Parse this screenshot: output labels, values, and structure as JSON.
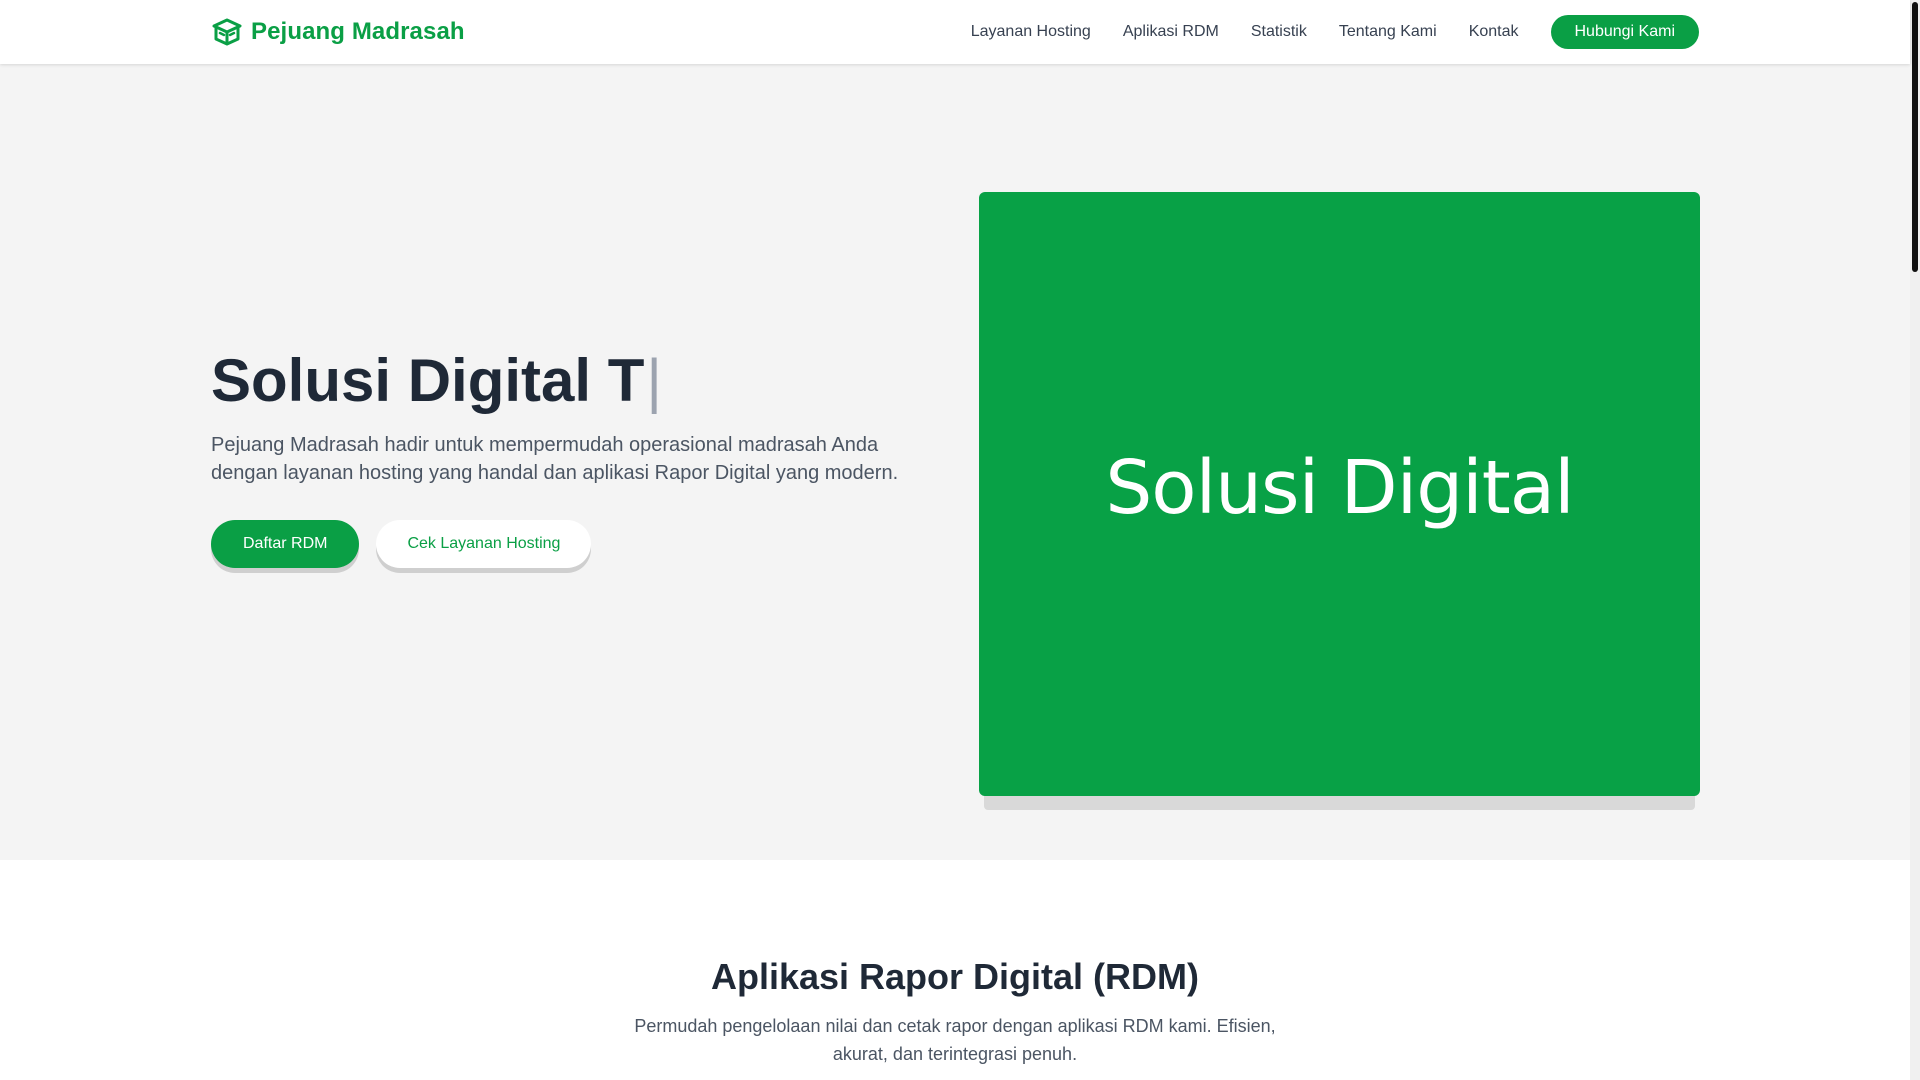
{
  "navbar": {
    "brand_name": "Pejuang Madrasah",
    "brand_icon": "madrasah-book-icon",
    "links": [
      "Layanan Hosting",
      "Aplikasi RDM",
      "Statistik",
      "Tentang Kami",
      "Kontak"
    ],
    "cta_label": "Hubungi Kami"
  },
  "hero": {
    "title_text": "Solusi Digital T",
    "cursor": "|",
    "description": "Pejuang Madrasah hadir untuk mempermudah operasional madrasah Anda dengan layanan hosting yang handal dan aplikasi Rapor Digital yang modern.",
    "primary_button": "Daftar RDM",
    "secondary_button": "Cek Layanan Hosting",
    "image_text": "Solusi Digital"
  },
  "rdm_section": {
    "title": "Aplikasi Rapor Digital (RDM)",
    "description": "Permudah pengelolaan nilai dan cetak rapor dengan aplikasi RDM kami. Efisien, akurat, dan terintegrasi penuh."
  },
  "colors": {
    "brand_green": "#0a9f45",
    "hero_background": "#f4f4f4",
    "text_dark": "#1f2937",
    "text_muted": "#4b5563"
  }
}
